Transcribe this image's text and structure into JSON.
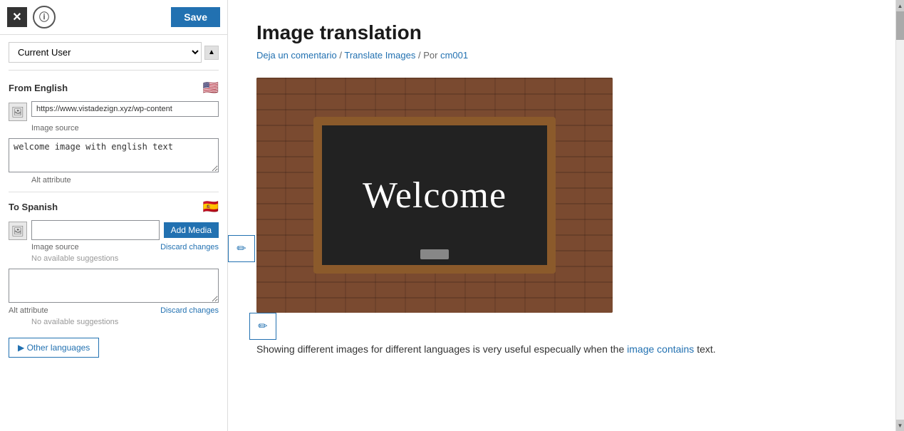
{
  "topbar": {
    "close_label": "✕",
    "info_label": "ⓘ",
    "save_label": "Save"
  },
  "user_select": {
    "value": "Current User",
    "options": [
      "Current User"
    ]
  },
  "from_section": {
    "title": "From English",
    "flag": "🇺🇸",
    "image_source_label": "Image source",
    "image_url": "https://www.vistadezign.xyz/wp-content",
    "alt_attribute_label": "Alt attribute",
    "alt_text": "welcome image with english text"
  },
  "to_section": {
    "title": "To Spanish",
    "flag": "🇪🇸",
    "image_source_label": "Image source",
    "image_url_placeholder": "",
    "add_media_label": "Add Media",
    "discard_changes_label": "Discard changes",
    "suggestions_label": "No available suggestions",
    "alt_attribute_label": "Alt attribute",
    "alt_placeholder": "",
    "alt_discard_label": "Discard changes",
    "alt_suggestions_label": "No available suggestions"
  },
  "other_languages_btn": "▶ Other languages",
  "article": {
    "title": "Image translation",
    "meta_comment": "Deja un comentario",
    "meta_separator1": "/",
    "meta_category": "Translate Images",
    "meta_separator2": "/",
    "meta_author_prefix": "Por",
    "meta_author": "cm001",
    "welcome_text": "Welcome",
    "description": "Showing different images for different languages is very useful especually when the",
    "description_link": "image contains",
    "description_end": "text."
  }
}
